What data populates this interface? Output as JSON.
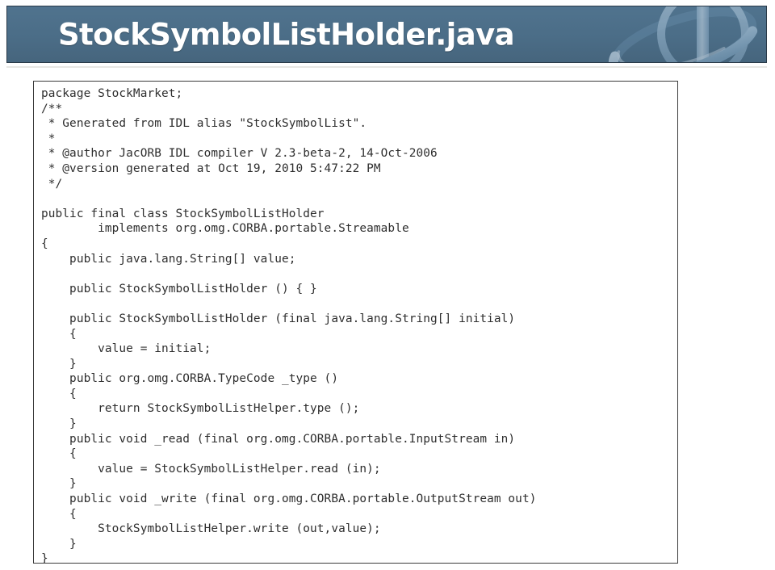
{
  "header": {
    "title": "StockSymbolListHolder.java",
    "background_color": "#4b6d87",
    "title_color": "#ffffff",
    "logo_icon": "globe-ring-icon"
  },
  "code_panel": {
    "language": "java",
    "border_color": "#3b3b3b",
    "background_color": "#ffffff",
    "text_color": "#2e2e2e",
    "lines": [
      "package StockMarket;",
      "/**",
      " * Generated from IDL alias \"StockSymbolList\".",
      " *",
      " * @author JacORB IDL compiler V 2.3-beta-2, 14-Oct-2006",
      " * @version generated at Oct 19, 2010 5:47:22 PM",
      " */",
      "",
      "public final class StockSymbolListHolder",
      "        implements org.omg.CORBA.portable.Streamable",
      "{",
      "    public java.lang.String[] value;",
      "",
      "    public StockSymbolListHolder () { }",
      "",
      "    public StockSymbolListHolder (final java.lang.String[] initial)",
      "    {",
      "        value = initial;",
      "    }",
      "    public org.omg.CORBA.TypeCode _type ()",
      "    {",
      "        return StockSymbolListHelper.type ();",
      "    }",
      "    public void _read (final org.omg.CORBA.portable.InputStream in)",
      "    {",
      "        value = StockSymbolListHelper.read (in);",
      "    }",
      "    public void _write (final org.omg.CORBA.portable.OutputStream out)",
      "    {",
      "        StockSymbolListHelper.write (out,value);",
      "    }",
      "}"
    ]
  }
}
